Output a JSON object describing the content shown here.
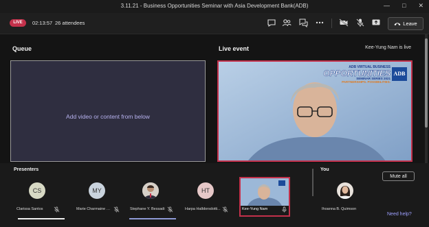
{
  "window": {
    "title": "3.11.21 - Business Opportunities Seminar with Asia Development Bank(ADB)",
    "controls": [
      "minimize-icon",
      "maximize-icon",
      "close-icon"
    ]
  },
  "toolbar": {
    "live_label": "LIVE",
    "elapsed": "02:13:57",
    "attendees": "26 attendees",
    "icons": [
      "chat-icon",
      "participants-icon",
      "qna-icon",
      "more-icon",
      "camera-off-icon",
      "mic-off-icon",
      "share-icon"
    ],
    "leave_label": "Leave"
  },
  "queue": {
    "title": "Queue",
    "placeholder": "Add video or content from below"
  },
  "live_event": {
    "title": "Live event",
    "status": "Kee-Yung Nam is live",
    "banner": {
      "line1": "ADB VIRTUAL BUSINESS",
      "line2": "OPPORTUNITIES",
      "line3": "SEMINAR SERIES 2021",
      "line4": "PARTNERSHIPS. POSSIBILITIES.",
      "logo": "ADB"
    }
  },
  "presenters": {
    "title": "Presenters",
    "items": [
      {
        "name": "Clarissa Santos",
        "initials": "CS",
        "color": "#d7d9c4"
      },
      {
        "name": "Marie Charmaine Si...",
        "initials": "MY",
        "color": "#c9d3dd"
      },
      {
        "name": "Stephane Y. Bessadi",
        "initials": "",
        "color": "#d6d0c8"
      },
      {
        "name": "Harpa Halldorsdotti...",
        "initials": "HT",
        "color": "#e6c8c8"
      },
      {
        "name": "Kee-Yung Nam",
        "initials": "",
        "color": "#9cb8d8"
      }
    ]
  },
  "you": {
    "title": "You",
    "name": "Ihoanna B. Quimson",
    "mute_all_label": "Mute all",
    "help_label": "Need help?"
  },
  "colors": {
    "accent_live": "#c4314b",
    "queue_bg": "#2f2e40",
    "placeholder_text": "#b8b3f0",
    "link": "#9ea0ff"
  }
}
